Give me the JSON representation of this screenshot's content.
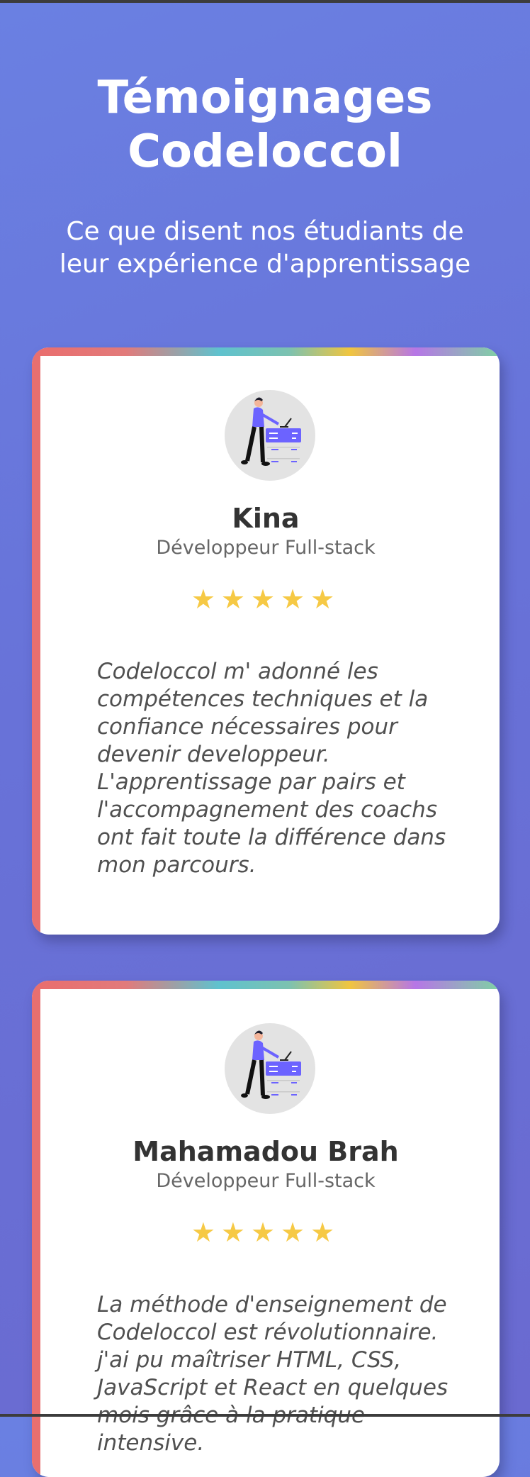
{
  "hero": {
    "title_line1": "Témoignages",
    "title_line2": "Codeloccol",
    "subtitle": "Ce que disent nos étudiants de leur expérience d'apprentissage"
  },
  "colors": {
    "background": "#6a78dc",
    "card": "#ffffff",
    "accent_left": "#e86f6f",
    "stars": "#f6c945",
    "avatar_bg": "#e3e3e3",
    "illustration": "#6c63ff"
  },
  "testimonials": [
    {
      "avatar_icon": "person-at-server-illustration",
      "name": "Kina",
      "role": "Développeur Full-stack",
      "rating": 5,
      "stars": "★★★★★",
      "quote": "Codeloccol m' adonné les compétences techniques et la confiance nécessaires pour devenir developpeur. L'apprentissage par pairs et l'accompagnement des coachs ont fait toute la différence dans mon parcours."
    },
    {
      "avatar_icon": "person-at-server-illustration",
      "name": "Mahamadou Brah",
      "role": "Développeur Full-stack",
      "rating": 5,
      "stars": "★★★★★",
      "quote": "La méthode d'enseignement de Codeloccol est révolutionnaire. j'ai pu maîtriser HTML, CSS, JavaScript et React en quelques mois grâce à la pratique intensive."
    }
  ]
}
